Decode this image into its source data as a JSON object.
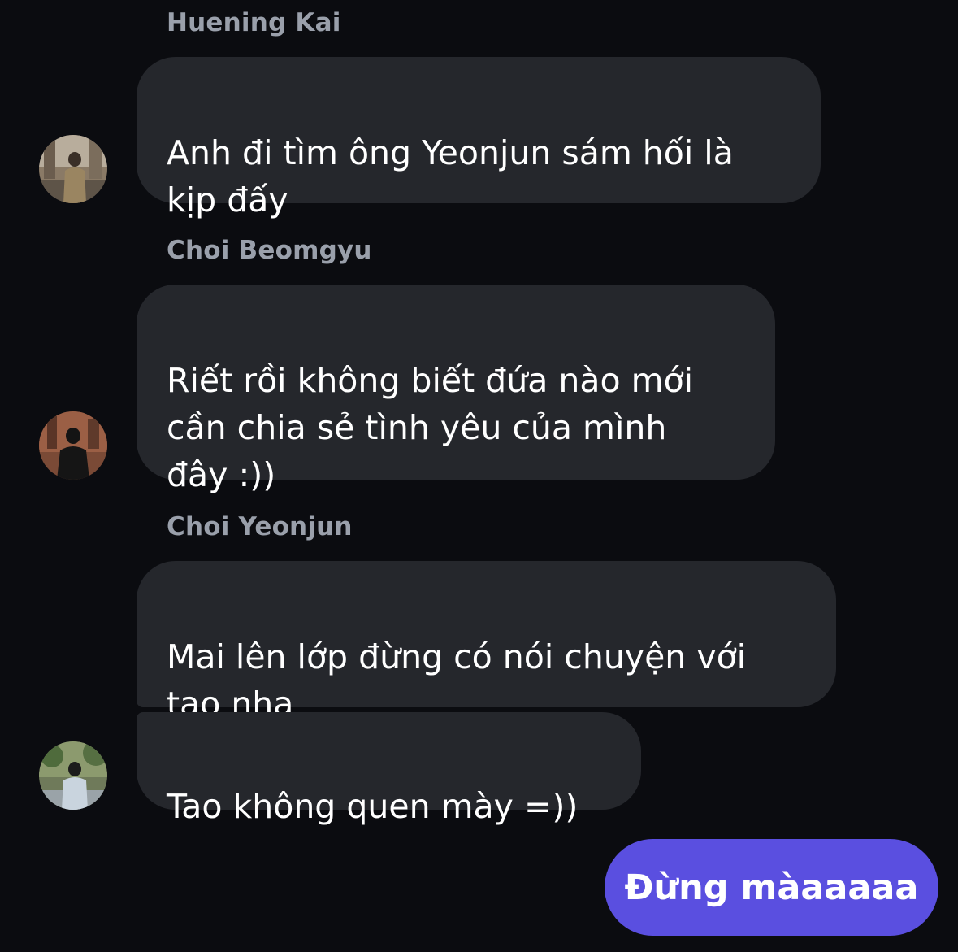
{
  "messages": [
    {
      "sender": "Huening Kai",
      "text": "Anh đi tìm ông Yeonjun sám hối là\nkịp đấy"
    },
    {
      "sender": "Choi Beomgyu",
      "text": "Riết rồi không biết đứa nào mới\ncần chia sẻ tình yêu của mình\nđây :))"
    },
    {
      "sender": "Choi Yeonjun",
      "text": "Mai lên lớp đừng có nói chuyện với\ntao nha",
      "text2": "Tao không quen mày =))"
    }
  ],
  "outgoing": {
    "text": "Đừng màaaaaa"
  },
  "colors": {
    "background": "#0b0c10",
    "incoming_bubble": "#25272c",
    "outgoing_bubble": "#5a4fe0",
    "sender_name": "#9aa0ab"
  }
}
